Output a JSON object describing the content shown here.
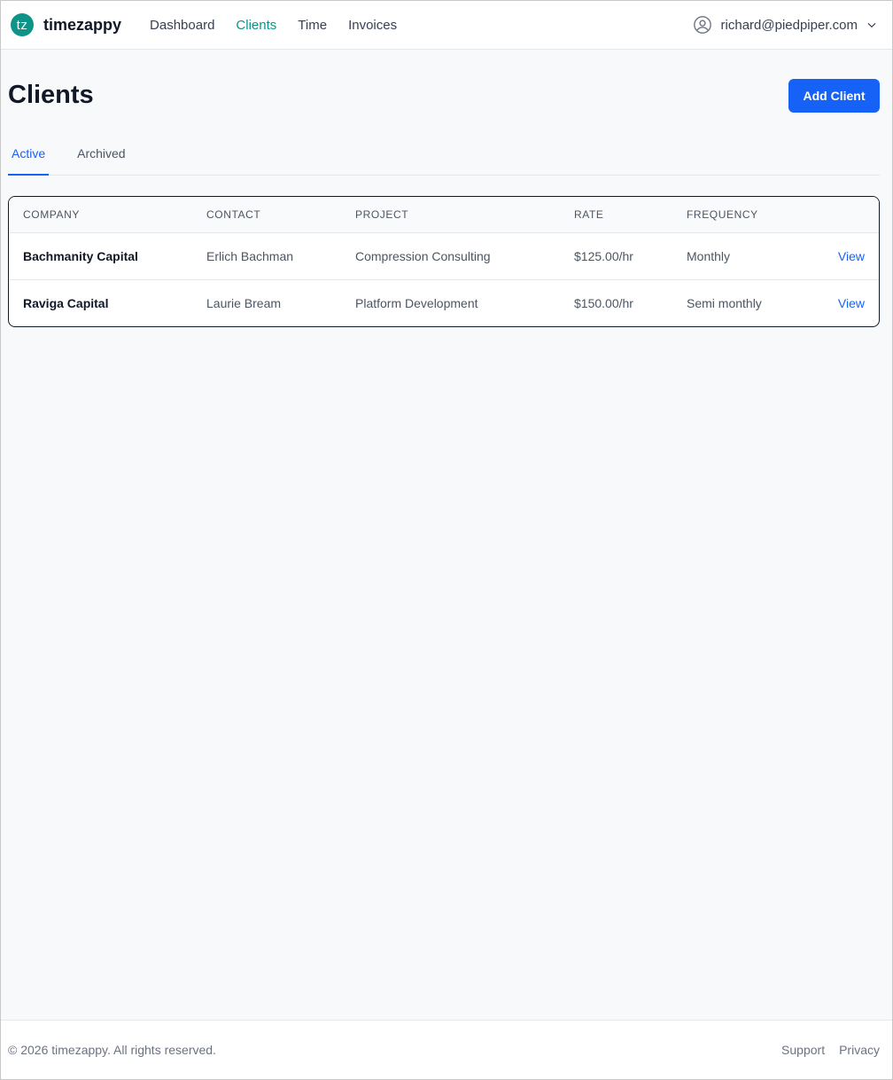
{
  "brand": {
    "mark": "tz",
    "name": "timezappy",
    "color": "#0d9488"
  },
  "nav": {
    "items": [
      {
        "label": "Dashboard",
        "active": false
      },
      {
        "label": "Clients",
        "active": true
      },
      {
        "label": "Time",
        "active": false
      },
      {
        "label": "Invoices",
        "active": false
      }
    ]
  },
  "user": {
    "email": "richard@piedpiper.com",
    "avatar_icon": "user-circle-icon",
    "menu_icon": "chevron-down-icon"
  },
  "page": {
    "title": "Clients",
    "add_button_label": "Add Client",
    "accent": "#1662f6"
  },
  "tabs": [
    {
      "label": "Active",
      "active": true
    },
    {
      "label": "Archived",
      "active": false
    }
  ],
  "table": {
    "headers": [
      "COMPANY",
      "CONTACT",
      "PROJECT",
      "RATE",
      "FREQUENCY"
    ],
    "rows": [
      {
        "company": "Bachmanity Capital",
        "contact": "Erlich Bachman",
        "project": "Compression Consulting",
        "rate": "$125.00/hr",
        "frequency": "Monthly",
        "action": "View"
      },
      {
        "company": "Raviga Capital",
        "contact": "Laurie Bream",
        "project": "Platform Development",
        "rate": "$150.00/hr",
        "frequency": "Semi monthly",
        "action": "View"
      }
    ]
  },
  "footer": {
    "copyright": "© 2026 timezappy. All rights reserved.",
    "links": [
      "Support",
      "Privacy"
    ]
  }
}
